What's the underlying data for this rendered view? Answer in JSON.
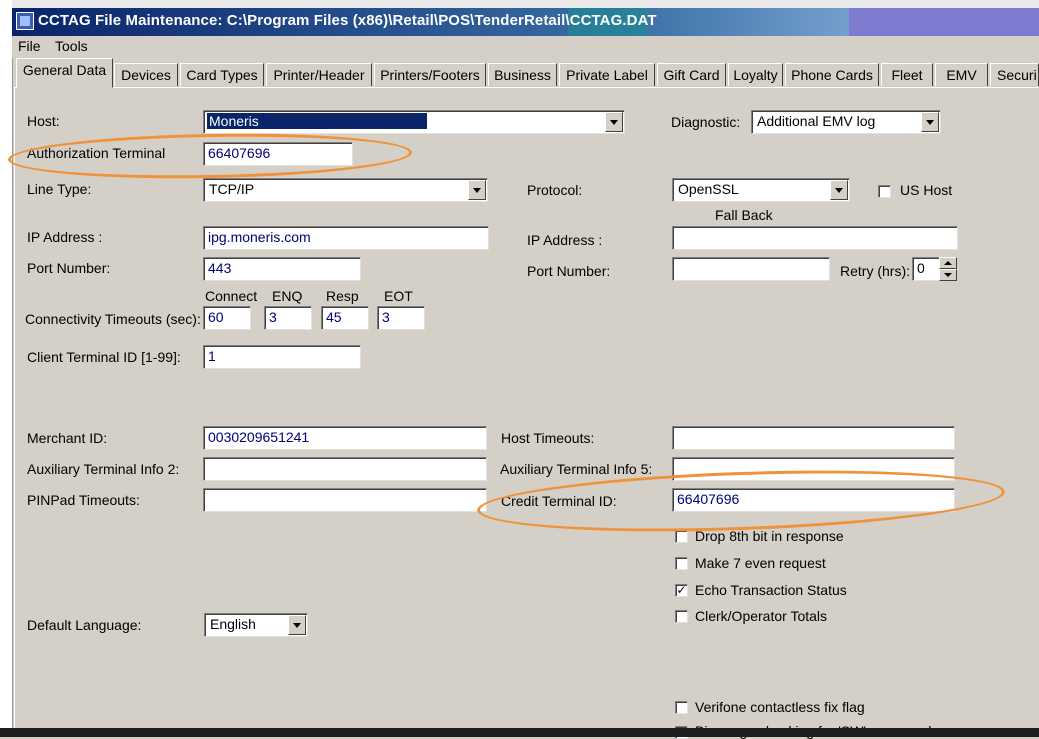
{
  "window": {
    "title": "CCTAG File Maintenance: C:\\Program Files (x86)\\Retail\\POS\\TenderRetail\\CCTAG.DAT",
    "icon": "app-icon"
  },
  "menu": {
    "file": "File",
    "tools": "Tools"
  },
  "tabs": [
    {
      "label": "General Data",
      "active": true
    },
    {
      "label": "Devices"
    },
    {
      "label": "Card Types"
    },
    {
      "label": "Printer/Header"
    },
    {
      "label": "Printers/Footers"
    },
    {
      "label": "Business"
    },
    {
      "label": "Private Label"
    },
    {
      "label": "Gift Card"
    },
    {
      "label": "Loyalty"
    },
    {
      "label": "Phone Cards"
    },
    {
      "label": "Fleet"
    },
    {
      "label": "EMV"
    },
    {
      "label": "Securi"
    }
  ],
  "form": {
    "host": {
      "label": "Host:",
      "value": "Moneris"
    },
    "auth_terminal": {
      "label": "Authorization Terminal",
      "value": "66407696"
    },
    "line_type": {
      "label": "Line Type:",
      "value": "TCP/IP"
    },
    "ip_address": {
      "label": "IP Address :",
      "value": "ipg.moneris.com"
    },
    "port_number": {
      "label": "Port Number:",
      "value": "443"
    },
    "timeouts": {
      "label": "Connectivity Timeouts (sec):",
      "connect_label": "Connect",
      "connect": "60",
      "enq_label": "ENQ",
      "enq": "3",
      "resp_label": "Resp",
      "resp": "45",
      "eot_label": "EOT",
      "eot": "3"
    },
    "client_terminal": {
      "label": "Client Terminal ID [1-99]:",
      "value": "1"
    },
    "merchant_id": {
      "label": "Merchant ID:",
      "value": "0030209651241"
    },
    "aux_info_2": {
      "label": "Auxiliary Terminal Info 2:",
      "value": ""
    },
    "pinpad_timeouts": {
      "label": "PINPad Timeouts:",
      "value": ""
    },
    "default_language": {
      "label": "Default Language:",
      "value": "English"
    },
    "diagnostic": {
      "label": "Diagnostic:",
      "value": "Additional EMV log"
    },
    "protocol": {
      "label": "Protocol:",
      "value": "OpenSSL"
    },
    "us_host": {
      "label": "US Host",
      "checked": false
    },
    "fallback": {
      "heading": "Fall Back",
      "ip_label": "IP Address :",
      "ip_value": "",
      "port_label": "Port Number:",
      "port_value": "",
      "retry_label": "Retry (hrs):",
      "retry_value": "0"
    },
    "host_timeouts": {
      "label": "Host Timeouts:",
      "value": ""
    },
    "aux_info_5": {
      "label": "Auxiliary Terminal Info 5:",
      "value": ""
    },
    "credit_terminal": {
      "label": "Credit Terminal ID:",
      "value": "66407696"
    },
    "checkboxes": [
      {
        "label": "Drop 8th bit in response",
        "checked": false
      },
      {
        "label": "Make 7 even request",
        "checked": false
      },
      {
        "label": "Echo Transaction Status",
        "checked": true
      },
      {
        "label": "Clerk/Operator Totals",
        "checked": false
      }
    ],
    "verifone": {
      "label": "Verifone contactless fix flag",
      "checked": false
    },
    "bin_range": {
      "label": "Bin range checking for 'SW' command",
      "checked": false
    }
  },
  "annotation_color": "#f0923a"
}
